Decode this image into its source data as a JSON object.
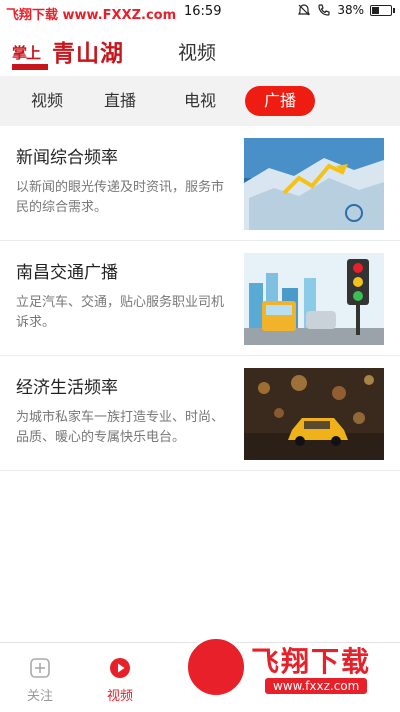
{
  "status_bar": {
    "watermark": "飞翔下载 www.FXXZ.com",
    "time": "16:59",
    "battery": "38%",
    "battery_level": 0.38
  },
  "header": {
    "logo_small": "掌上",
    "logo_big": "青山湖",
    "title": "视频"
  },
  "tabs": [
    {
      "label": "视频",
      "active": false
    },
    {
      "label": "直播",
      "active": false
    },
    {
      "label": "电视",
      "active": false
    },
    {
      "label": "广播",
      "active": true
    }
  ],
  "channels": [
    {
      "title": "新闻综合频率",
      "desc": "以新闻的眼光传递及时资讯，服务市民的综合需求。"
    },
    {
      "title": "南昌交通广播",
      "desc": "立足汽车、交通，贴心服务职业司机诉求。"
    },
    {
      "title": "经济生活频率",
      "desc": "为城市私家车一族打造专业、时尚、品质、暖心的专属快乐电台。"
    }
  ],
  "bottom_nav": [
    {
      "label": "关注",
      "icon": "follow-icon",
      "active": false
    },
    {
      "label": "视频",
      "icon": "play-icon",
      "active": true
    }
  ],
  "watermark_badge": {
    "main": "飞翔下载",
    "url": "www.fxxz.com"
  },
  "colors": {
    "accent": "#ef1d11",
    "logo": "#c8161d",
    "tab_bg": "#f2f2f2"
  }
}
